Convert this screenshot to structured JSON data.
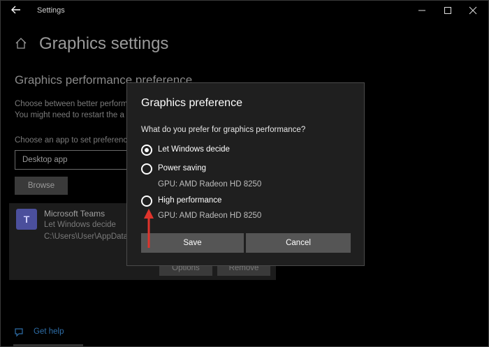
{
  "titlebar": {
    "title": "Settings",
    "back_icon": "arrow-left-icon",
    "minimize_icon": "minimize-icon",
    "maximize_icon": "maximize-icon",
    "close_icon": "close-icon"
  },
  "page": {
    "title": "Graphics settings",
    "section_title": "Graphics performance preference",
    "desc_line1": "Choose between better perform",
    "desc_line2": "You might need to restart the a",
    "choose_label": "Choose an app to set preferenc",
    "app_type_value": "Desktop app",
    "browse_label": "Browse",
    "app_card": {
      "name": "Microsoft Teams",
      "preference": "Let Windows decide",
      "path": "C:\\Users\\User\\AppData",
      "options_label": "Options",
      "remove_label": "Remove"
    },
    "help_label": "Get help"
  },
  "dialog": {
    "title": "Graphics preference",
    "question": "What do you prefer for graphics performance?",
    "options": [
      {
        "label": "Let Windows decide",
        "checked": true
      },
      {
        "label": "Power saving",
        "checked": false,
        "gpu": "GPU: AMD Radeon HD 8250"
      },
      {
        "label": "High performance",
        "checked": false,
        "gpu": "GPU: AMD Radeon HD 8250"
      }
    ],
    "save_label": "Save",
    "cancel_label": "Cancel"
  },
  "colors": {
    "background": "#000000",
    "dialog_bg": "#1f1f1f",
    "button_bg": "#555555",
    "annotation_arrow": "#e0342c",
    "link": "#2e6ea8"
  }
}
